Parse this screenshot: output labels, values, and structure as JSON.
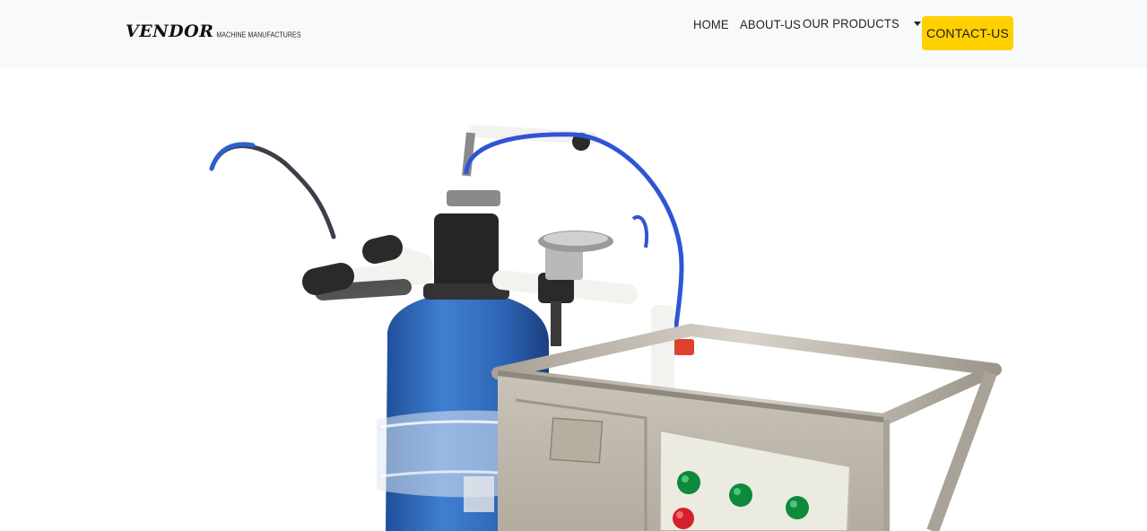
{
  "brand": {
    "name": "VENDOR",
    "tagline": "MACHINE MANUFACTURES"
  },
  "nav": {
    "home": "HOME",
    "about": "ABOUT-US",
    "products": "OUR PRODUCTS",
    "contact": "CONTACT-US"
  },
  "hero": {
    "image_alt_icon": "water-softener-machine-image"
  },
  "colors": {
    "accent": "#ffd000",
    "navbar_bg": "#f8f9fa",
    "tank_blue": "#2f67b8"
  }
}
